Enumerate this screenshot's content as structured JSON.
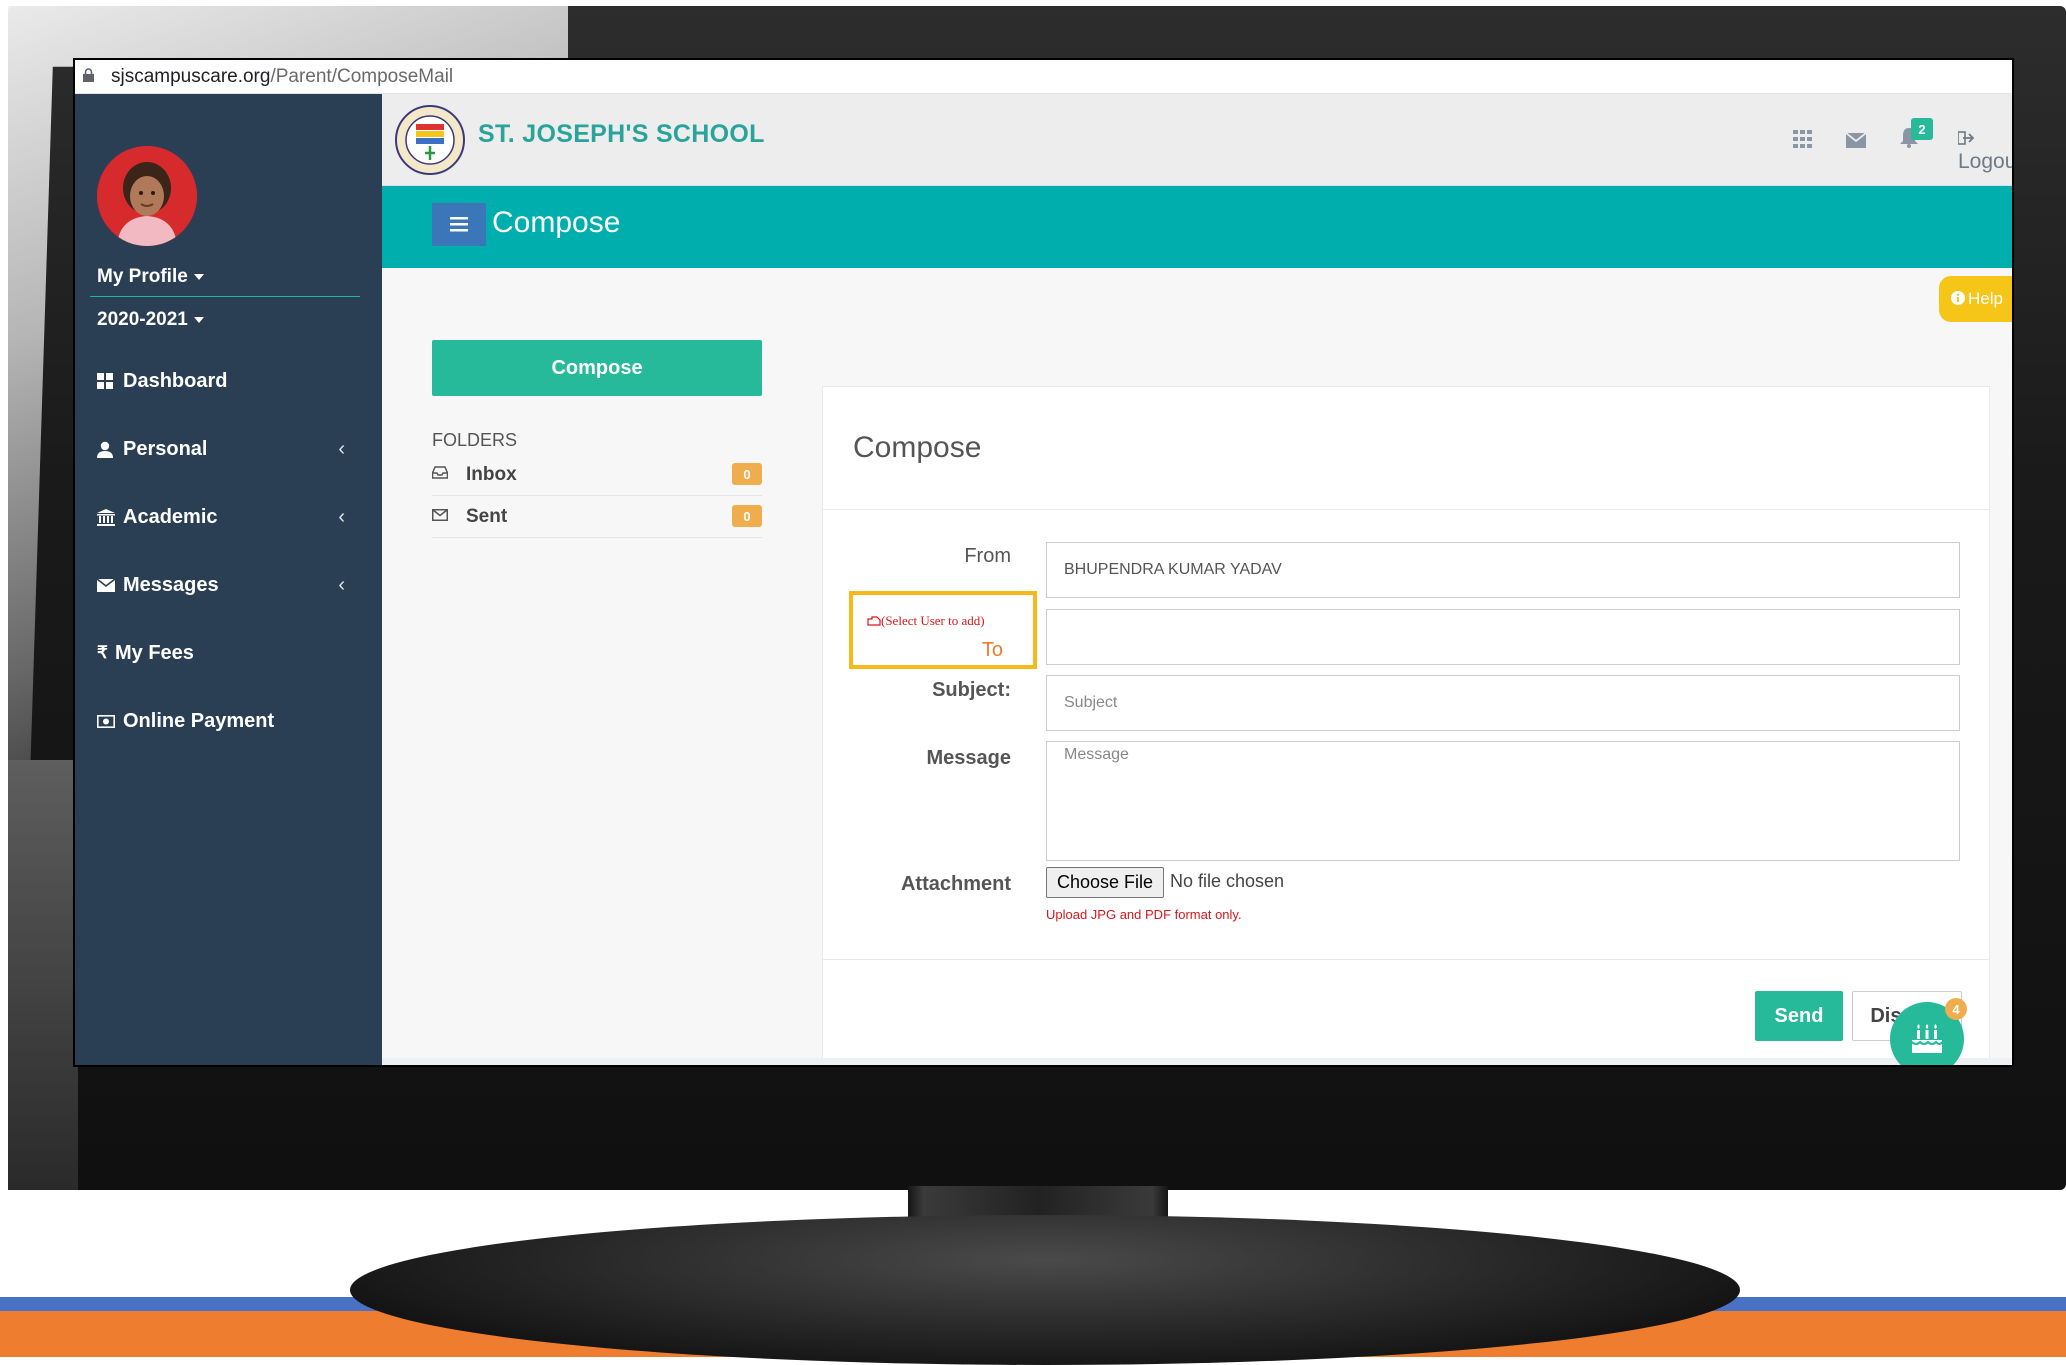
{
  "browser": {
    "url_host": "sjscampuscare.org",
    "url_path": "/Parent/ComposeMail"
  },
  "sidebar": {
    "profile_label": "My Profile",
    "year_label": "2020-2021",
    "items": [
      {
        "label": "Dashboard",
        "icon": "dashboard-icon"
      },
      {
        "label": "Personal",
        "icon": "user-icon"
      },
      {
        "label": "Academic",
        "icon": "bank-icon"
      },
      {
        "label": "Messages",
        "icon": "envelope-icon"
      },
      {
        "label": "My Fees",
        "icon": "rupee-icon"
      },
      {
        "label": "Online Payment",
        "icon": "money-icon"
      }
    ],
    "chevron": "‹"
  },
  "header": {
    "school_name": "ST. JOSEPH'S SCHOOL",
    "notification_count": "2",
    "logout_label": "Logout"
  },
  "page": {
    "title": "Compose",
    "help_label": "Help"
  },
  "mail": {
    "compose_button": "Compose",
    "folders_label": "FOLDERS",
    "folders": [
      {
        "label": "Inbox",
        "count": "0"
      },
      {
        "label": "Sent",
        "count": "0"
      }
    ]
  },
  "form": {
    "title": "Compose",
    "from_label": "From",
    "from_value": "BHUPENDRA KUMAR YADAV",
    "to_hint": "(Select User to add)",
    "to_label": "To",
    "subject_label": "Subject:",
    "subject_placeholder": "Subject",
    "message_label": "Message",
    "message_placeholder": "Message",
    "attachment_label": "Attachment",
    "file_button": "Choose File",
    "file_status": "No file chosen",
    "upload_note": "Upload JPG and PDF format only.",
    "send_label": "Send",
    "discard_label": "Discard"
  },
  "chat": {
    "badge": "4"
  },
  "colors": {
    "accent": "#26b99a",
    "teal": "#00aeae",
    "sidebar": "#2a3f54",
    "warning": "#f0ad4e",
    "highlight": "#f6b81b"
  }
}
